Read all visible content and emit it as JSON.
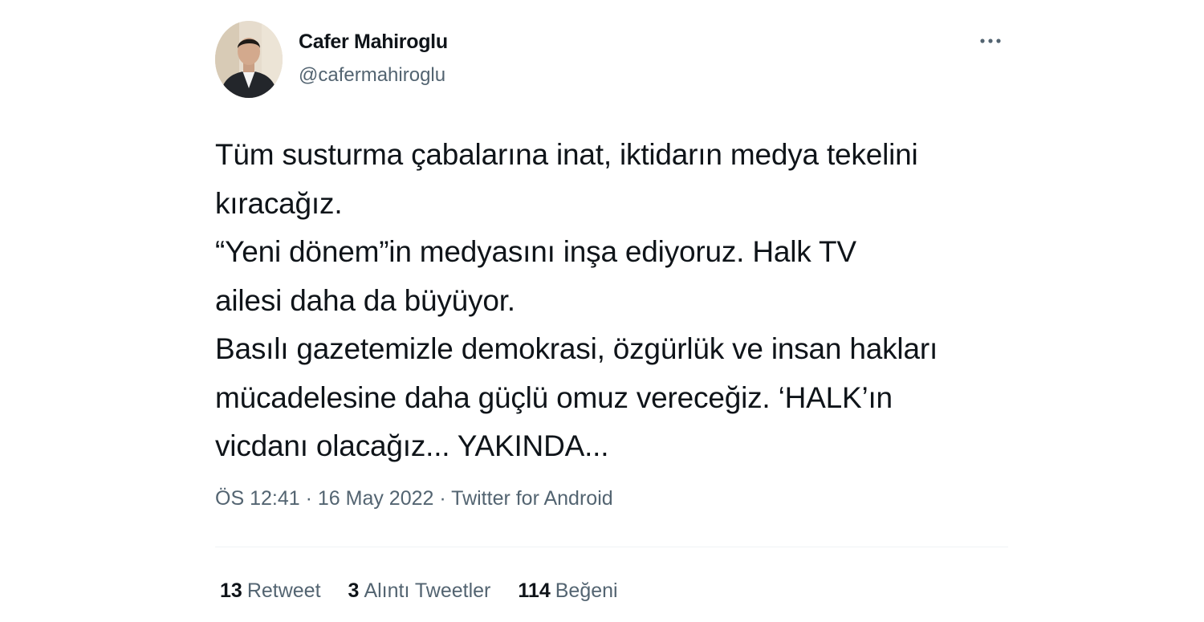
{
  "author": {
    "display_name": "Cafer Mahiroglu",
    "handle": "@cafermahiroglu",
    "avatar_icon": "profile-photo"
  },
  "more_icon": "more-horizontal-icon",
  "tweet": {
    "text": "Tüm susturma çabalarına inat, iktidarın medya tekelini\nkıracağız.\n “Yeni dönem”in medyasını inşa ediyoruz. Halk TV\nailesi daha da büyüyor.\nBasılı gazetemizle demokrasi, özgürlük ve insan hakları\nmücadelesine daha güçlü omuz vereceğiz. ‘HALK’ın\nvicdanı olacağız... YAKINDA..."
  },
  "meta": {
    "time": "ÖS 12:41",
    "separator_1": " · ",
    "date": "16 May 2022",
    "separator_2": " · ",
    "source": "Twitter for Android"
  },
  "stats": {
    "retweets_count": "13",
    "retweets_label": "Retweet",
    "quotes_count": "3",
    "quotes_label": "Alıntı Tweetler",
    "likes_count": "114",
    "likes_label": "Beğeni"
  },
  "colors": {
    "text_primary": "#0f1419",
    "text_secondary": "#536471",
    "divider": "#eff3f4",
    "background": "#ffffff"
  }
}
